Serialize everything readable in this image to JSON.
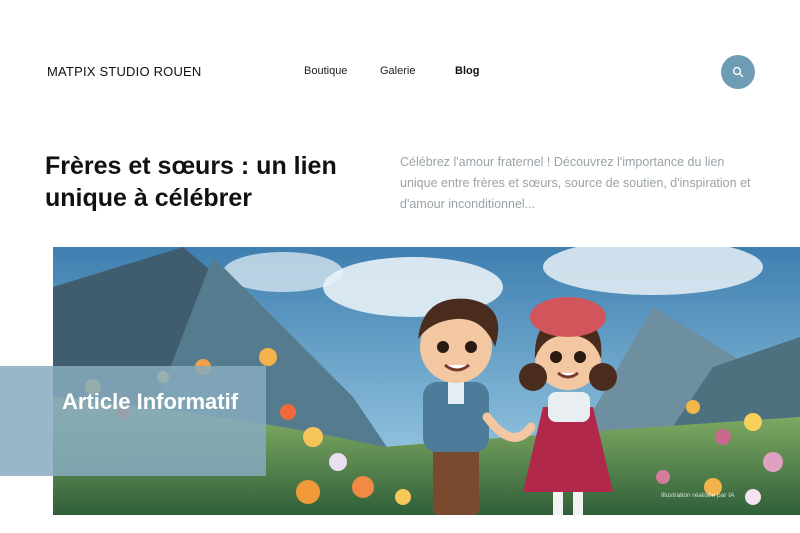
{
  "header": {
    "brand": "MATPIX STUDIO ROUEN",
    "nav": [
      {
        "label": "Boutique"
      },
      {
        "label": "Galerie"
      },
      {
        "label": "Blog"
      }
    ],
    "search_icon": "search-icon"
  },
  "article": {
    "title": "Frères et sœurs : un lien unique à célébrer",
    "excerpt": "Célébrez l'amour fraternel ! Découvrez l'importance du lien unique entre frères et sœurs, source de soutien, d'inspiration et d'amour inconditionnel...",
    "badge": "Article Informatif",
    "image_credit": "Illustration réalisée par IA"
  },
  "colors": {
    "accent": "#6d9cb4",
    "badge": "#87aabe",
    "excerpt_text": "#9aa3a8"
  }
}
